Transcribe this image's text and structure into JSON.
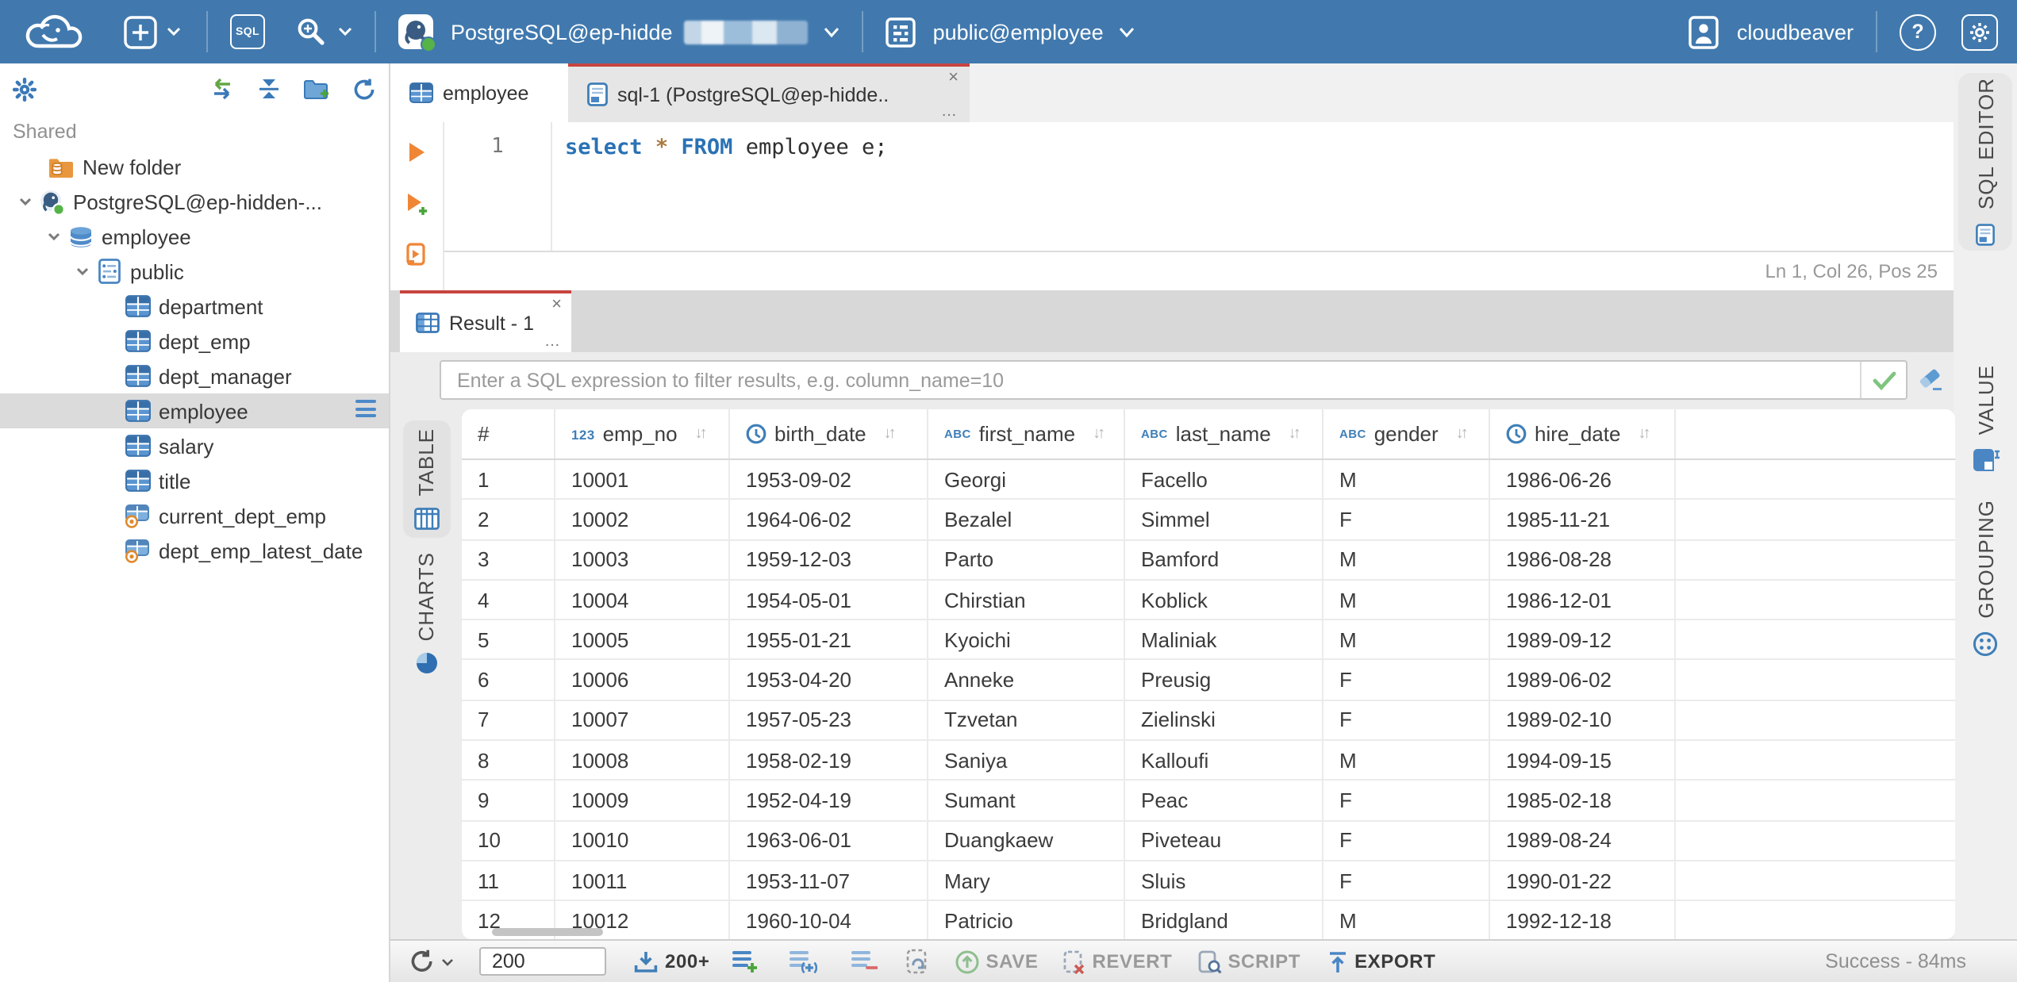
{
  "topbar": {
    "logo_icon": "cloudbeaver-logo",
    "new_connection": {
      "icon": "plus-square-icon"
    },
    "sql_editor_button": {
      "label": "SQL"
    },
    "driver_tools": {
      "icon": "wrench-icon"
    },
    "connection_selector": {
      "icon": "postgres-icon",
      "label": "PostgreSQL@ep-hidde",
      "redacted": true,
      "status": "connected",
      "status_color": "#56b347"
    },
    "schema_selector": {
      "icon": "schema-icon",
      "label": "public@employee"
    },
    "user": {
      "icon": "user-icon",
      "label": "cloudbeaver"
    },
    "help_label": "?",
    "settings_icon": "gear-icon"
  },
  "sidebar": {
    "toolbar_icons": [
      "settings-gear-icon",
      "sync-arrows-icon",
      "collapse-all-icon",
      "new-folder-icon",
      "refresh-icon"
    ],
    "section_label": "Shared",
    "tree": [
      {
        "label": "New folder",
        "icon": "folder-database-icon",
        "level": 1,
        "chevron": false
      },
      {
        "label": "PostgreSQL@ep-hidden-...",
        "icon": "postgres-connection-icon",
        "level": 0,
        "chevron": true
      },
      {
        "label": "employee",
        "icon": "database-icon",
        "level": 1,
        "chevron": true
      },
      {
        "label": "public",
        "icon": "schema-doc-icon",
        "level": 2,
        "chevron": true
      },
      {
        "label": "department",
        "icon": "table-icon",
        "level": 3,
        "chevron": false
      },
      {
        "label": "dept_emp",
        "icon": "table-icon",
        "level": 3,
        "chevron": false
      },
      {
        "label": "dept_manager",
        "icon": "table-icon",
        "level": 3,
        "chevron": false
      },
      {
        "label": "employee",
        "icon": "table-icon",
        "level": 3,
        "chevron": false,
        "selected": true,
        "menu": true
      },
      {
        "label": "salary",
        "icon": "table-icon",
        "level": 3,
        "chevron": false
      },
      {
        "label": "title",
        "icon": "table-icon",
        "level": 3,
        "chevron": false
      },
      {
        "label": "current_dept_emp",
        "icon": "view-icon",
        "level": 3,
        "chevron": false
      },
      {
        "label": "dept_emp_latest_date",
        "icon": "view-icon",
        "level": 3,
        "chevron": false
      }
    ]
  },
  "editor": {
    "tabs": [
      {
        "label": "employee",
        "icon": "table-icon",
        "active": false
      },
      {
        "label": "sql-1 (PostgreSQL@ep-hidde...",
        "icon": "sql-script-icon",
        "active": true,
        "close_glyph": "×",
        "more_glyph": "…"
      }
    ],
    "gutter": {
      "line_number": "1",
      "icons": [
        "execute-icon",
        "execute-new-tab-icon",
        "execute-script-icon"
      ]
    },
    "sql_tokens": [
      {
        "text": "select",
        "type": "keyword"
      },
      {
        "text": " ",
        "type": "plain"
      },
      {
        "text": "*",
        "type": "star"
      },
      {
        "text": " ",
        "type": "plain"
      },
      {
        "text": "FROM",
        "type": "keyword"
      },
      {
        "text": " employee e;",
        "type": "plain"
      }
    ],
    "status": "Ln 1, Col 26, Pos 25",
    "right_tab": {
      "label": "SQL EDITOR",
      "icon": "sql-script-icon"
    }
  },
  "result": {
    "tab": {
      "label": "Result - 1",
      "icon": "result-grid-icon",
      "close_glyph": "×",
      "more_glyph": "…"
    },
    "filter": {
      "placeholder": "Enter a SQL expression to filter results, e.g. column_name=10",
      "value": "",
      "apply_icon": "check-icon",
      "clear_icon": "eraser-icon"
    },
    "left_tabs": [
      {
        "label": "TABLE",
        "icon": "table-grid-icon",
        "active": true
      },
      {
        "label": "CHARTS",
        "icon": "pie-chart-icon",
        "active": false
      }
    ],
    "right_tabs": [
      {
        "label": "VALUE",
        "icon": "value-panel-icon"
      },
      {
        "label": "GROUPING",
        "icon": "grouping-icon"
      }
    ],
    "grid": {
      "type_badges": {
        "number": "123",
        "string": "ABC"
      },
      "sort_glyph": "↓↑",
      "columns": [
        {
          "label": "#",
          "type": "index"
        },
        {
          "label": "emp_no",
          "type": "number"
        },
        {
          "label": "birth_date",
          "type": "datetime"
        },
        {
          "label": "first_name",
          "type": "string"
        },
        {
          "label": "last_name",
          "type": "string"
        },
        {
          "label": "gender",
          "type": "string"
        },
        {
          "label": "hire_date",
          "type": "datetime"
        }
      ],
      "rows": [
        [
          "1",
          "10001",
          "1953-09-02",
          "Georgi",
          "Facello",
          "M",
          "1986-06-26"
        ],
        [
          "2",
          "10002",
          "1964-06-02",
          "Bezalel",
          "Simmel",
          "F",
          "1985-11-21"
        ],
        [
          "3",
          "10003",
          "1959-12-03",
          "Parto",
          "Bamford",
          "M",
          "1986-08-28"
        ],
        [
          "4",
          "10004",
          "1954-05-01",
          "Chirstian",
          "Koblick",
          "M",
          "1986-12-01"
        ],
        [
          "5",
          "10005",
          "1955-01-21",
          "Kyoichi",
          "Maliniak",
          "M",
          "1989-09-12"
        ],
        [
          "6",
          "10006",
          "1953-04-20",
          "Anneke",
          "Preusig",
          "F",
          "1989-06-02"
        ],
        [
          "7",
          "10007",
          "1957-05-23",
          "Tzvetan",
          "Zielinski",
          "F",
          "1989-02-10"
        ],
        [
          "8",
          "10008",
          "1958-02-19",
          "Saniya",
          "Kalloufi",
          "M",
          "1994-09-15"
        ],
        [
          "9",
          "10009",
          "1952-04-19",
          "Sumant",
          "Peac",
          "F",
          "1985-02-18"
        ],
        [
          "10",
          "10010",
          "1963-06-01",
          "Duangkaew",
          "Piveteau",
          "F",
          "1989-08-24"
        ],
        [
          "11",
          "10011",
          "1953-11-07",
          "Mary",
          "Sluis",
          "F",
          "1990-01-22"
        ],
        [
          "12",
          "10012",
          "1960-10-04",
          "Patricio",
          "Bridgland",
          "M",
          "1992-12-18"
        ]
      ]
    },
    "toolbar": {
      "row_limit": "200",
      "fetch_more_label": "200+",
      "save_label": "SAVE",
      "revert_label": "REVERT",
      "script_label": "SCRIPT",
      "export_label": "EXPORT",
      "status": "Success - 84ms"
    }
  },
  "colors": {
    "header_blue": "#4179ae",
    "accent_red": "#c64540",
    "icon_blue": "#3f7fb8",
    "keyword_blue": "#2a72b5",
    "star_tan": "#a9793f",
    "connected_green": "#56b347",
    "execute_orange": "#ef8636"
  }
}
